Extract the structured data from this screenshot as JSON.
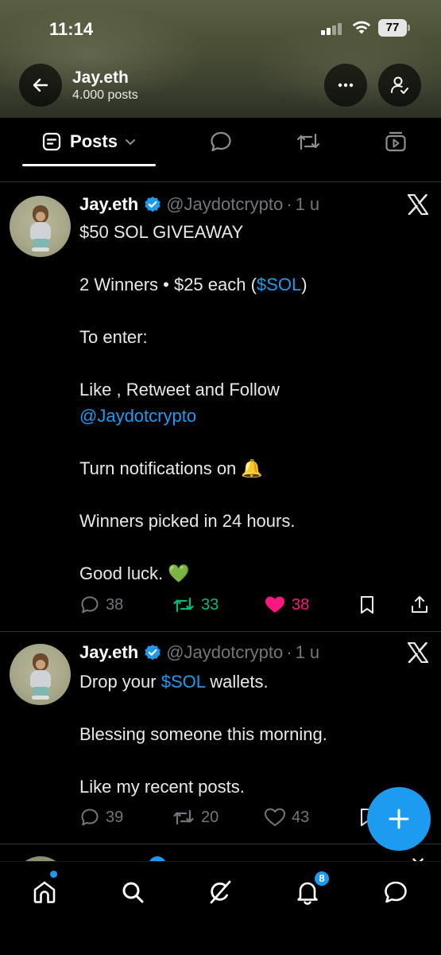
{
  "status_bar": {
    "time": "11:14",
    "battery": "77"
  },
  "header": {
    "name": "Jay.eth",
    "post_count": "4.000 posts"
  },
  "tabs": [
    {
      "label": "Posts",
      "icon": "posts-icon",
      "active": true
    },
    {
      "label": "",
      "icon": "replies-icon"
    },
    {
      "label": "",
      "icon": "reposts-icon"
    },
    {
      "label": "",
      "icon": "media-icon"
    }
  ],
  "posts": [
    {
      "author": "Jay.eth",
      "handle": "@Jaydotcrypto",
      "separator": "·",
      "age": "1 u",
      "lines": [
        {
          "text": "$50 SOL GIVEAWAY"
        },
        {
          "text": ""
        },
        {
          "pre": "2 Winners • $25 each (",
          "link": "$SOL",
          "post": ")"
        },
        {
          "text": ""
        },
        {
          "text": "To enter:"
        },
        {
          "text": ""
        },
        {
          "text": "Like , Retweet and Follow"
        },
        {
          "link": "@Jaydotcrypto"
        },
        {
          "text": ""
        },
        {
          "text": "Turn notifications on 🔔"
        },
        {
          "text": ""
        },
        {
          "text": "Winners picked in 24 hours."
        },
        {
          "text": ""
        },
        {
          "text": "Good luck. 💚"
        }
      ],
      "replies": "38",
      "reposts": "33",
      "likes": "38",
      "reposted_by_me": true,
      "liked_by_me": true
    },
    {
      "author": "Jay.eth",
      "handle": "@Jaydotcrypto",
      "separator": "·",
      "age": "1 u",
      "lines": [
        {
          "pre": "Drop your ",
          "link": "$SOL",
          "post": " wallets."
        },
        {
          "text": ""
        },
        {
          "text": "Blessing someone this morning."
        },
        {
          "text": ""
        },
        {
          "text": "Like my recent posts."
        }
      ],
      "replies": "39",
      "reposts": "20",
      "likes": "43",
      "reposted_by_me": false,
      "liked_by_me": false
    }
  ],
  "nav": {
    "items": [
      "home-icon",
      "search-icon",
      "grok-icon",
      "notifications-icon",
      "messages-icon"
    ],
    "notification_count": "8"
  },
  "colors": {
    "accent": "#1d9bf0",
    "repost_active": "#00ba7c",
    "like_active": "#f91880",
    "muted": "#71767b"
  }
}
